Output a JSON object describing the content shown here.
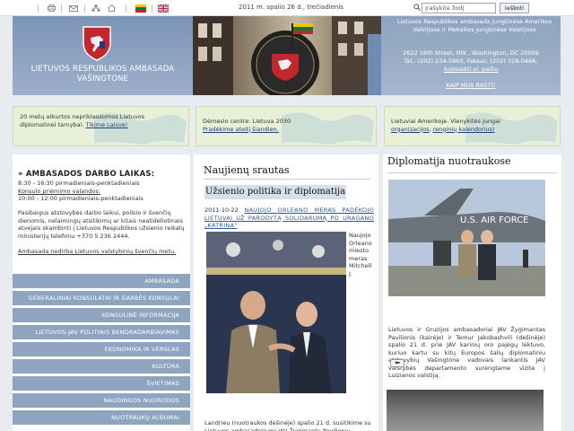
{
  "topbar": {
    "date": "2011 m. spalio 26 d., trečiadienis",
    "icons": [
      "home-icon",
      "print-icon",
      "mail-icon",
      "sitemap-icon",
      "flag-lt-icon",
      "flag-us-icon"
    ],
    "search_placeholder": "įrašykite žodį",
    "search_button": "Ieškoti"
  },
  "header": {
    "embassy_name": "LIETUVOS RESPUBLIKOS AMBASADA VAŠINGTONE",
    "right_title": "Lietuvos Respublikos ambasada Jungtinėse Amerikos Valstijose ir Meksikos Jungtinėse Valstijose",
    "address_line1": "2622 16th Street, NW , Washington, DC 20009",
    "address_line2": "Tel.: (202) 234-5860, Faksas: (202) 328-0466,",
    "contact_link": "Susisiekti el. paštu",
    "find_us": "KAIP MUS RASTI?"
  },
  "banners": [
    {
      "text": "20 metų atkurtos nepriklausomos Lietuvos diplomatinei tarnybai.",
      "link": "Tikime Laisve!"
    },
    {
      "text": "Dėmesio centre: Lietuva 2030",
      "link": "Pradėkime ateitį šiandien."
    },
    {
      "text": "Lietuviai Amerikoje. Vienykitės jungai",
      "link": "organizacijos",
      "link2": "renginių kalendorius!",
      "joiner": ", "
    }
  ],
  "hours": {
    "title": "AMBASADOS DARBO LAIKAS:",
    "line1": "8:30 - 16:30    pirmadieniais-penktadieniais",
    "consul_title": "Konsulo priėmimo valandos:",
    "line2": "10:00 - 12:00   pirmadieniais-penktadieniais",
    "para": "Pasibaigus atstovybės darbo laikui, poilsio ir švenčių dienomis, nelaimingų atsitikimų ar kitais neatidėliotinais atvejais skambinti į Lietuvos Respublikos užsienio reikalų ministerijų telefonu +370 5 236 2444.",
    "holiday_note": "Ambasada nedirba Lietuvos valstybinių švenčių metu."
  },
  "menu": [
    "AMBASADA",
    "GENERALINIAI KONSULATAI IR GARBĖS KONSULAI",
    "KONSULINĖ INFORMACIJA",
    "LIETUVOS-JAV POLITINIS BENDRADARBIAVIMAS",
    "EKONOMIKA IR VERSLAS",
    "KULTŪRA",
    "ŠVIETIMAS",
    "NAUDINGOS NUORODOS",
    "NUOTRAUKŲ ALBUMAI"
  ],
  "news": {
    "title": "Naujienų srautas",
    "section": "Užsienio politika ir diplomatija",
    "date": "2011-10-22",
    "headline": "NAUJOJO ORLEANO MERAS PADĖKOJO LIETUVAI UŽ PARODYTĄ SOLIDARUMĄ PO URAGANO „KATRINA\"",
    "side_caption": "Naujojo Orleano miesto meras Mitchell J.",
    "bottom_text": "Landrieu (nuotraukos dešinėje) spalio 21 d. susitikime su Lietuvos ambasadoriumi JAV Žygimantu Pavilioniu"
  },
  "photos": {
    "title": "Diplomatija nuotraukose",
    "plane_text": "U.S. AIR FORCE",
    "caption": "Lietuvos ir Gruzijos ambasadoriai JAV Žygimantas Pavilionis (kairėje) ir Temur Jakobashvili (dešinėje) spalio 21 d. prie JAV karinių oro pajėgų lėktuvo, kuriuo kartu su kitų Europos šalių diplomatiniu atstovybių Vašingtone vadovais lankantis JAV valstybės departamento surengtame vizite į Luizianos valstiją.",
    "prev_label": "⬅"
  },
  "colors": {
    "menu_bg": "#8fa4c1",
    "banner_bg": "#e9f0d8",
    "section_bg": "#d7e0ea",
    "link": "#1a3f7a"
  }
}
